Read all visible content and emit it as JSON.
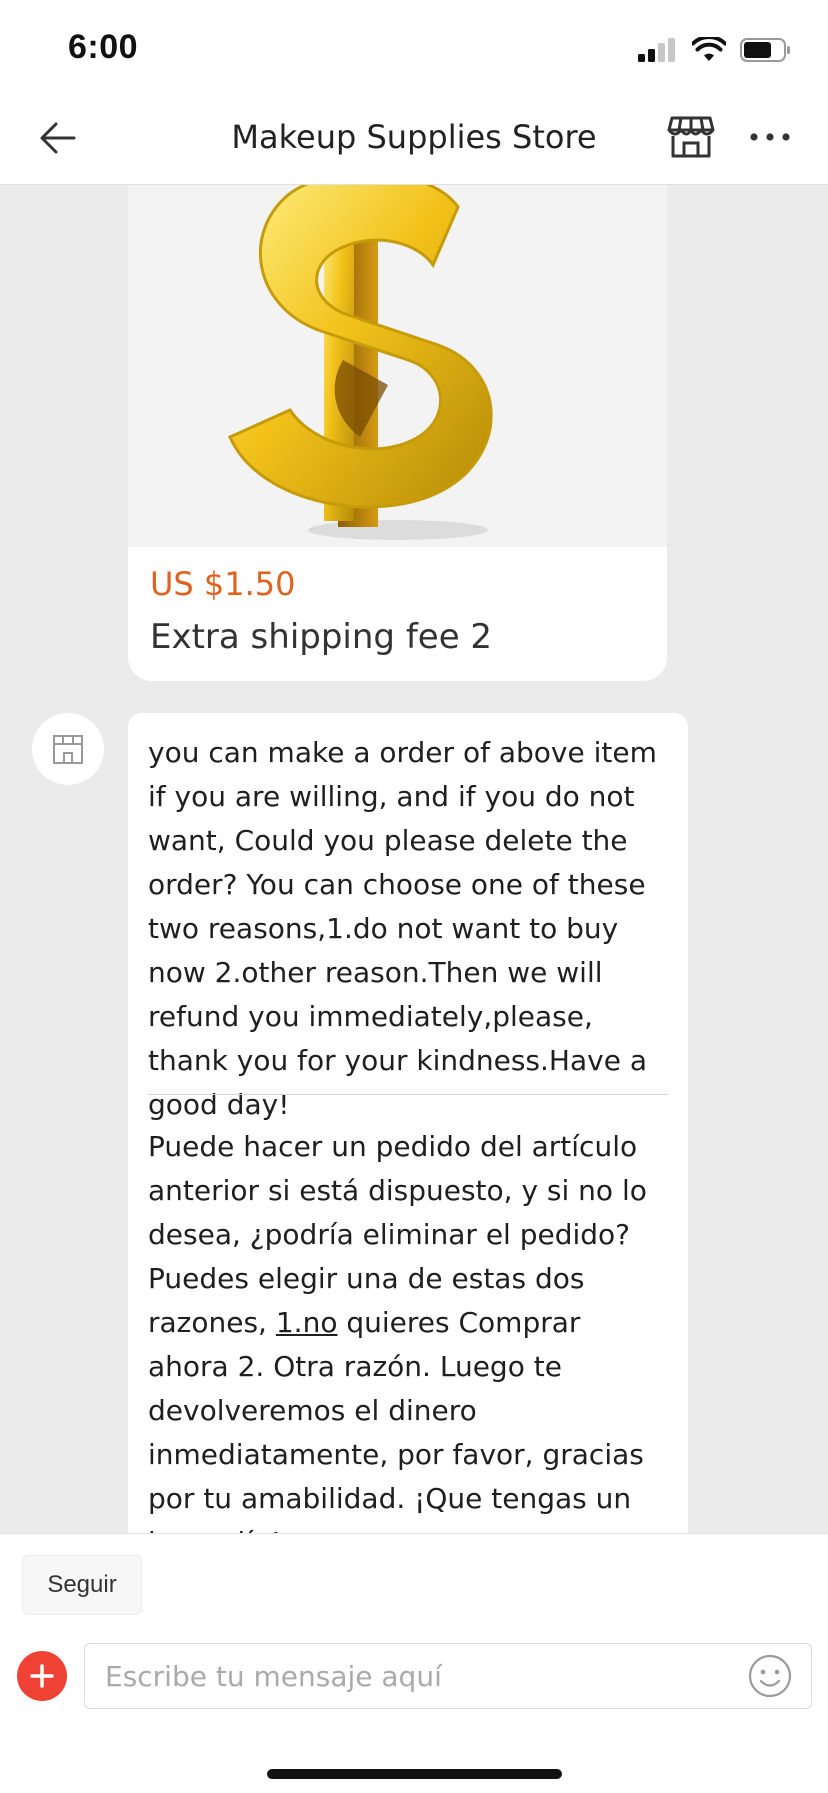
{
  "status_bar": {
    "time": "6:00"
  },
  "header": {
    "title": "Makeup Supplies Store"
  },
  "product_card": {
    "price": "US $1.50",
    "title": "Extra shipping fee 2"
  },
  "message": {
    "english_text": "you can make a order of above item if you are willing, and if you do not want, Could you please delete the order? You can choose one of these two reasons,1.do not want to buy now 2.other reason.Then we will refund you immediately,please, thank you for your kindness.Have a good day!",
    "spanish_before_link": "Puede hacer un pedido del artículo anterior si está dispuesto, y si no lo desea, ¿podría eliminar el pedido? Puedes elegir una de estas dos razones, ",
    "spanish_link": "1.no",
    "spanish_after_link": " quieres Comprar ahora 2. Otra razón. Luego te devolveremos el dinero inmediatamente, por favor, gracias por tu amabilidad. ¡Que tengas un buen día!"
  },
  "bottom_bar": {
    "follow_label": "Seguir",
    "input_placeholder": "Escribe tu mensaje aquí"
  },
  "icons": {
    "back": "back-arrow-icon",
    "store": "store-icon",
    "more": "more-icon",
    "add": "plus-icon",
    "emoji": "emoji-icon"
  },
  "colors": {
    "price": "#e0621f",
    "add_button": "#f04234"
  }
}
